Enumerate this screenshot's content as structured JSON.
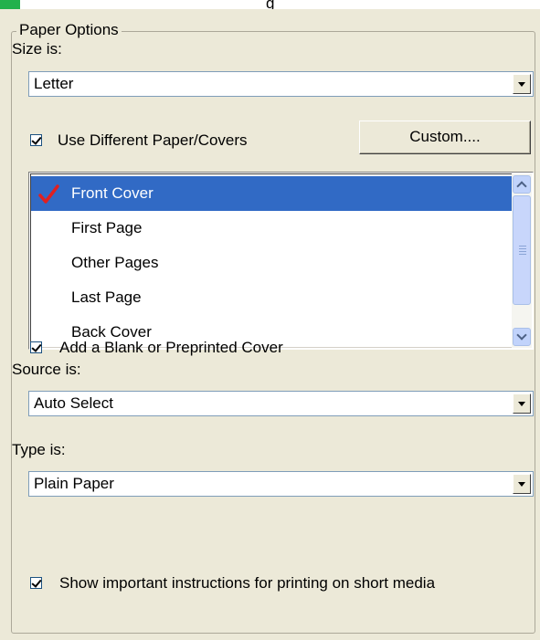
{
  "header_fragment": "g",
  "group": {
    "title": "Paper Options"
  },
  "size": {
    "label": "Size is:",
    "value": "Letter"
  },
  "use_different": {
    "label": "Use Different Paper/Covers",
    "checked": true
  },
  "custom_button": "Custom....",
  "pages": {
    "items": [
      {
        "label": "Front Cover",
        "selected": true,
        "checked": true
      },
      {
        "label": "First Page",
        "selected": false,
        "checked": false
      },
      {
        "label": "Other Pages",
        "selected": false,
        "checked": false
      },
      {
        "label": "Last Page",
        "selected": false,
        "checked": false
      },
      {
        "label": "Back Cover",
        "selected": false,
        "checked": false
      }
    ]
  },
  "add_blank": {
    "label": "Add a Blank or Preprinted Cover",
    "checked": true
  },
  "source": {
    "label": "Source is:",
    "value": "Auto Select"
  },
  "type": {
    "label": "Type is:",
    "value": "Plain Paper"
  },
  "short_media": {
    "label": "Show important instructions for printing on short media",
    "checked": true
  },
  "colors": {
    "selection": "#316ac5",
    "panel": "#ece9d8",
    "tick": "#e02020",
    "brand_strip": "#22b14c"
  },
  "icons": {
    "tick": "checkmark-icon",
    "combo_arrow": "chevron-down-icon",
    "scroll_up": "chevron-up-icon",
    "scroll_down": "chevron-down-icon"
  }
}
